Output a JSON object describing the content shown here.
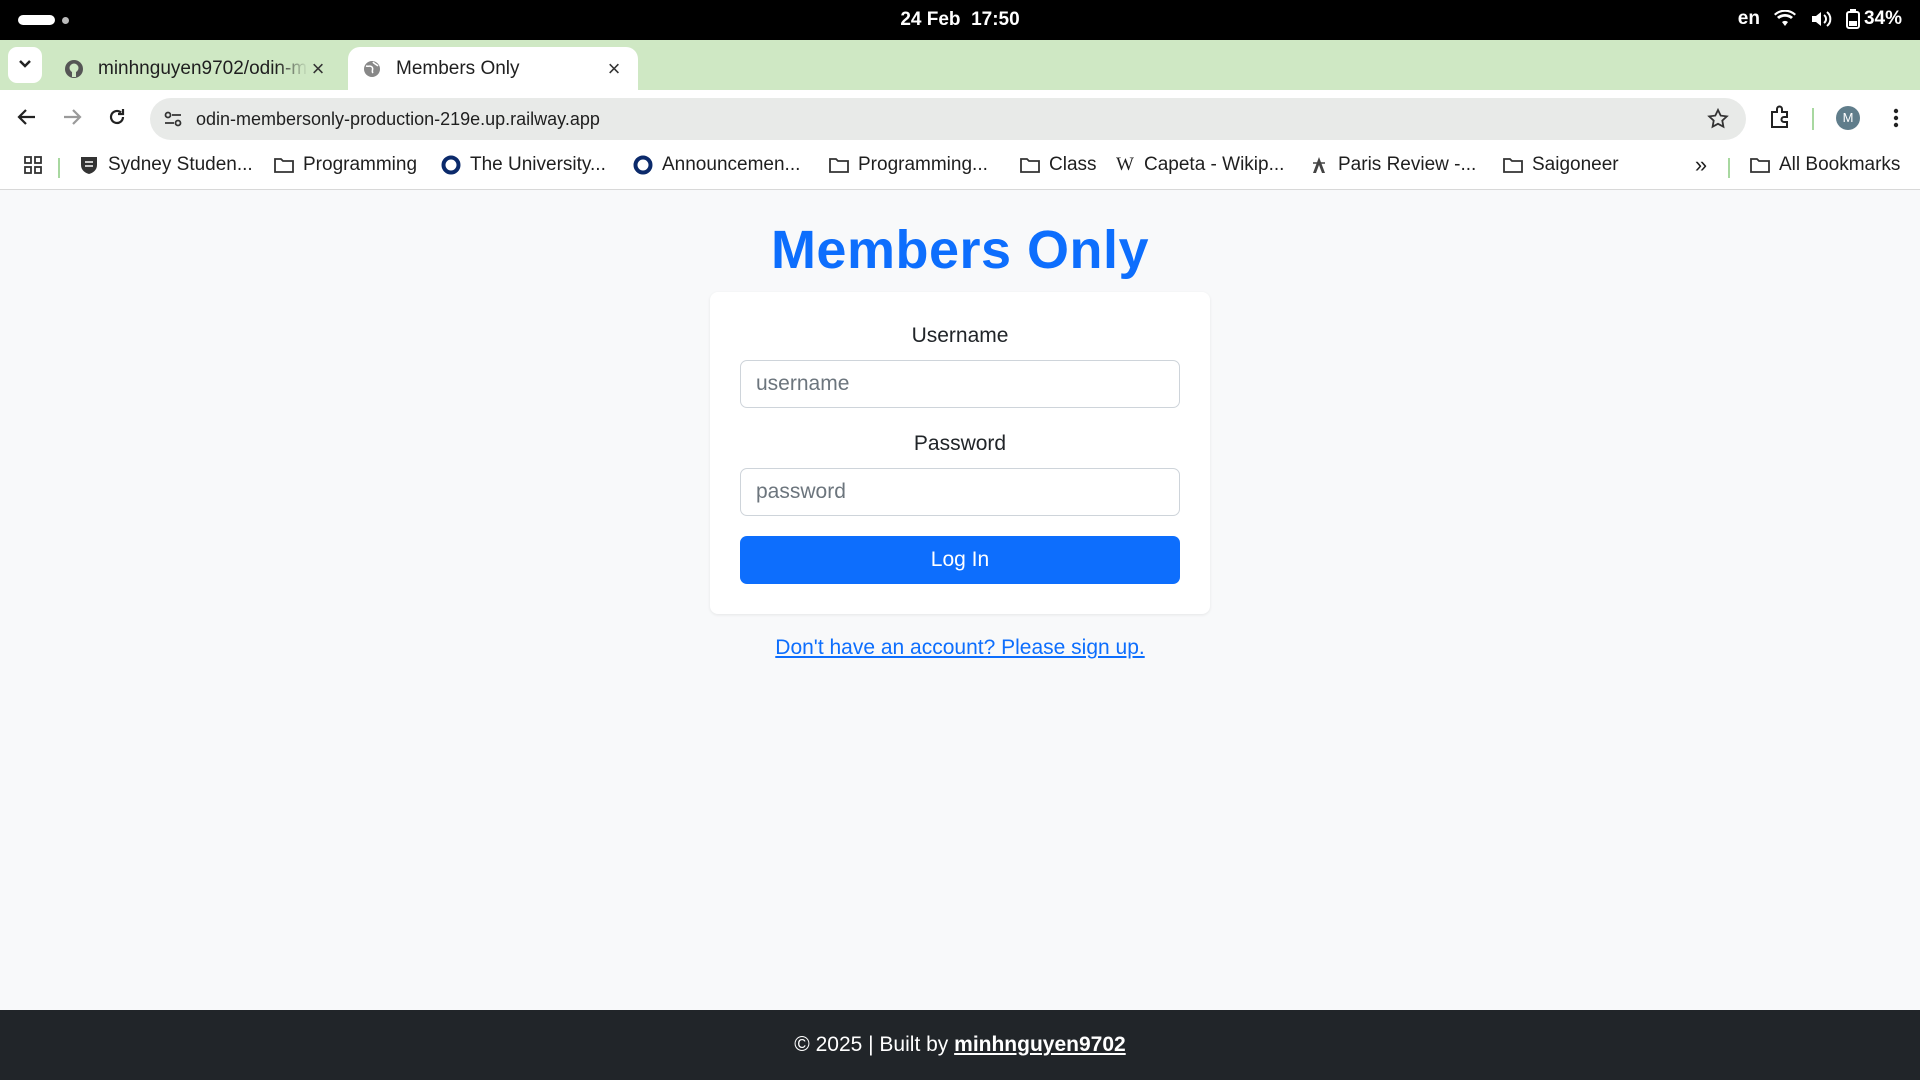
{
  "os": {
    "date": "24 Feb",
    "time": "17:50",
    "keyboard": "en",
    "battery": "34%"
  },
  "tabs": [
    {
      "title": "minhnguyen9702/odin-m",
      "icon": "github-icon",
      "active": false
    },
    {
      "title": "Members Only",
      "icon": "globe-icon",
      "active": true
    }
  ],
  "address": {
    "url": "odin-membersonly-production-219e.up.railway.app"
  },
  "profile": {
    "initial": "M"
  },
  "bookmarks": {
    "items": [
      {
        "label": "Sydney Studen...",
        "icon": "crest-icon"
      },
      {
        "label": "Programming",
        "icon": "folder-icon"
      },
      {
        "label": "The University...",
        "icon": "ring-icon"
      },
      {
        "label": "Announcemen...",
        "icon": "ring-icon"
      },
      {
        "label": "Programming...",
        "icon": "folder-icon"
      },
      {
        "label": "Class",
        "icon": "folder-icon"
      },
      {
        "label": "Capeta - Wikip...",
        "icon": "wikipedia-icon"
      },
      {
        "label": "Paris Review -...",
        "icon": "paris-review-icon"
      },
      {
        "label": "Saigoneer",
        "icon": "folder-icon"
      }
    ],
    "all_label": "All Bookmarks"
  },
  "page": {
    "title": "Members Only",
    "username_label": "Username",
    "username_placeholder": "username",
    "password_label": "Password",
    "password_placeholder": "password",
    "login_label": "Log In",
    "signup_link": "Don't have an account? Please sign up."
  },
  "footer": {
    "prefix": "© 2025 | Built by ",
    "author": "minhnguyen9702"
  },
  "colors": {
    "primary": "#0d6efd",
    "footer_bg": "#212529",
    "tabstrip_bg": "#cfe8c4"
  }
}
